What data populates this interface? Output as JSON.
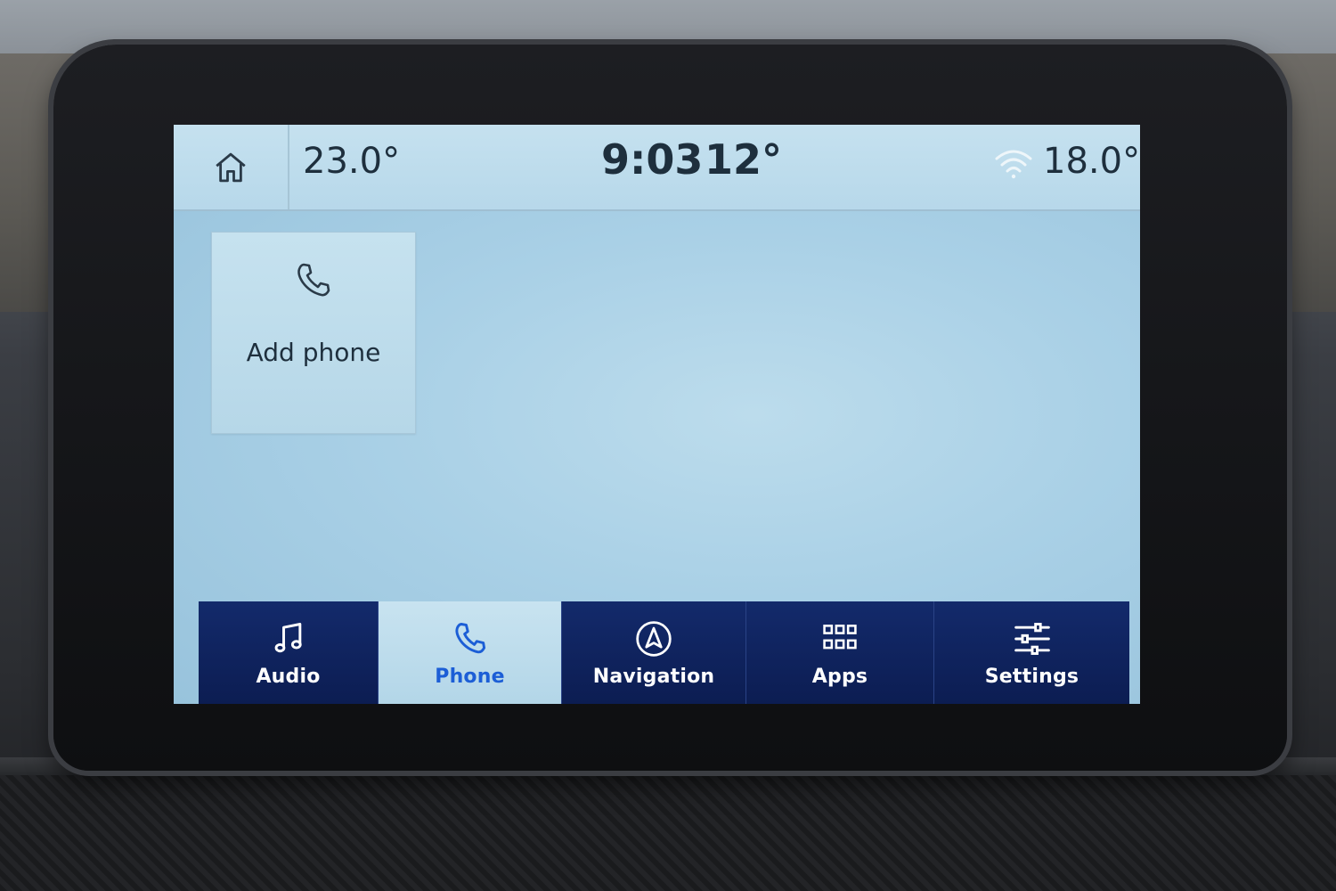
{
  "status_bar": {
    "left_temperature": "23.0°",
    "time": "9:03",
    "outside_temperature": "12°",
    "right_temperature": "18.0°"
  },
  "main": {
    "add_phone_label": "Add phone"
  },
  "nav": {
    "items": [
      {
        "label": "Audio",
        "icon": "music-note-icon"
      },
      {
        "label": "Phone",
        "icon": "phone-icon",
        "active": true
      },
      {
        "label": "Navigation",
        "icon": "navigation-icon"
      },
      {
        "label": "Apps",
        "icon": "apps-grid-icon"
      },
      {
        "label": "Settings",
        "icon": "sliders-icon"
      }
    ]
  },
  "colors": {
    "nav_background": "#0c1d52",
    "active_label": "#1c5ed6",
    "screen_background": "#a9d0e6"
  }
}
